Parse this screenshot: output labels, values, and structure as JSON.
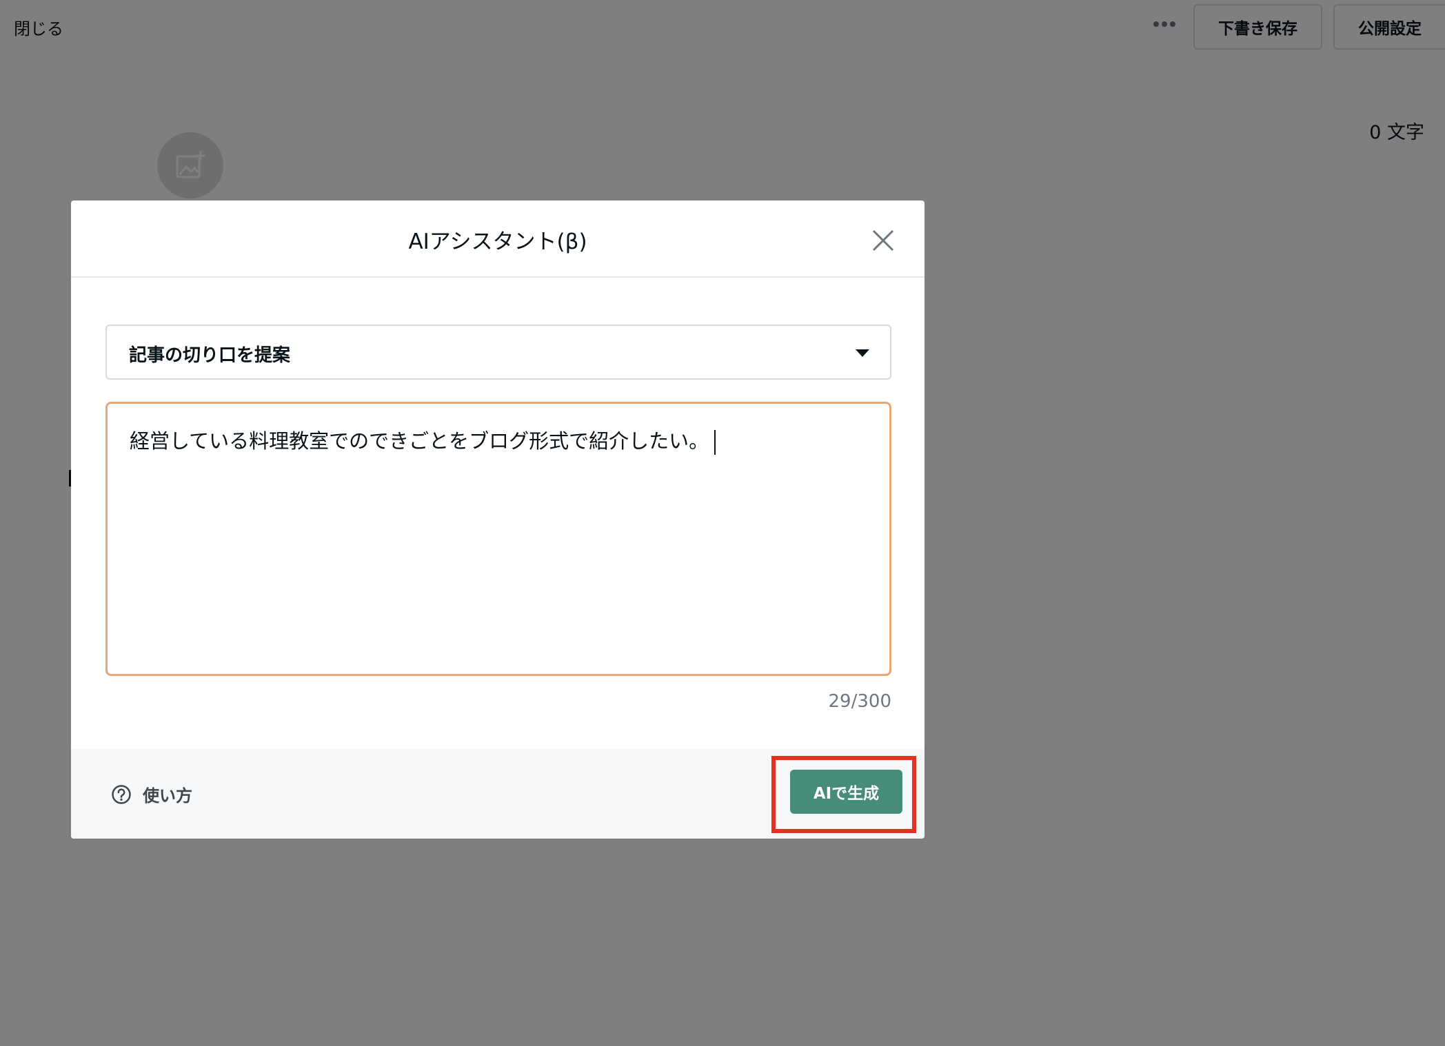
{
  "editor": {
    "close_label": "閉じる",
    "more_icon": "more-horizontal-icon",
    "draft_button": "下書き保存",
    "publish_button": "公開設定",
    "char_count": "0 文字",
    "image_icon": "add-image-icon"
  },
  "modal": {
    "title": "AIアシスタント(β)",
    "close_icon": "close-icon",
    "select": {
      "value": "記事の切り口を提案",
      "caret_icon": "caret-down-icon"
    },
    "prompt": {
      "value": "経営している料理教室でのできごとをブログ形式で紹介したい。"
    },
    "counter": "29/300",
    "footer": {
      "help_icon": "question-circle-icon",
      "help_label": "使い方",
      "generate_button": "AIで生成"
    }
  },
  "colors": {
    "overlay": "rgba(0,0,0,0.5)",
    "prompt_border": "#e8a679",
    "generate_button": "#468c78",
    "highlight": "#e5311f",
    "footer_bg": "#f5f7f9"
  }
}
